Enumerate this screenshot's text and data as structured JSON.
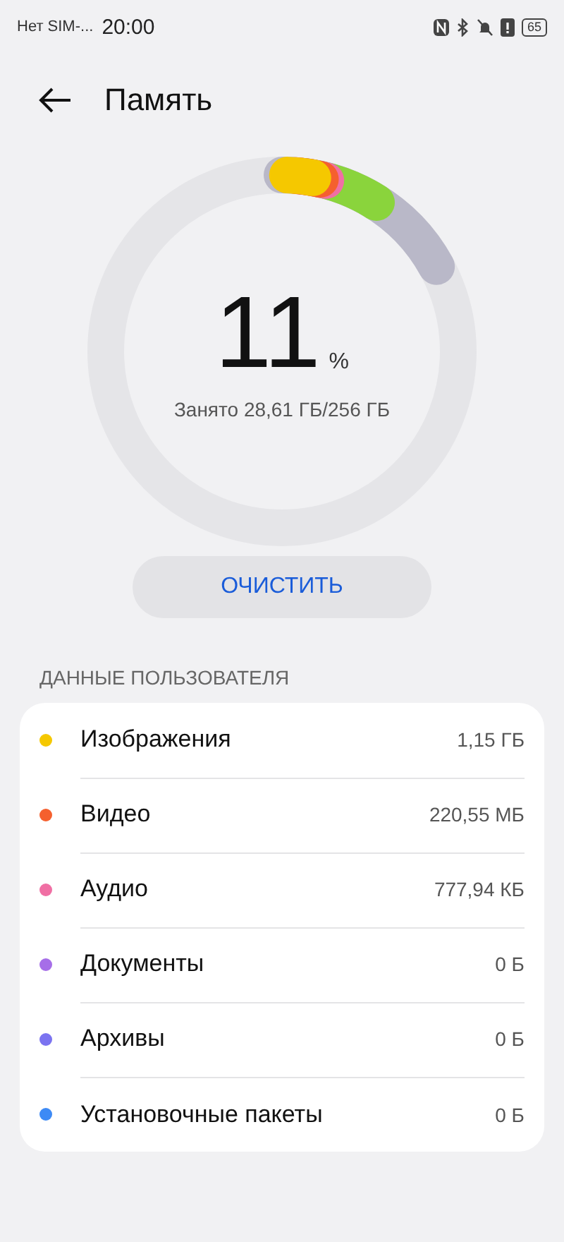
{
  "status_bar": {
    "carrier": "Нет SIM-...",
    "time": "20:00",
    "battery": "65"
  },
  "header": {
    "title": "Память"
  },
  "usage": {
    "percent": "11",
    "unit": "%",
    "summary": "Занято 28,61 ГБ/256 ГБ"
  },
  "clean_button": "ОЧИСТИТЬ",
  "section_title": "ДАННЫЕ ПОЛЬЗОВАТЕЛЯ",
  "categories": [
    {
      "name": "Изображения",
      "size": "1,15 ГБ",
      "color": "#f5c800"
    },
    {
      "name": "Видео",
      "size": "220,55 МБ",
      "color": "#f5602e"
    },
    {
      "name": "Аудио",
      "size": "777,94 КБ",
      "color": "#f06fa4"
    },
    {
      "name": "Документы",
      "size": "0 Б",
      "color": "#a66ee8"
    },
    {
      "name": "Архивы",
      "size": "0 Б",
      "color": "#7b73f0"
    },
    {
      "name": "Установочные пакеты",
      "size": "0 Б",
      "color": "#3d8af5"
    }
  ]
}
